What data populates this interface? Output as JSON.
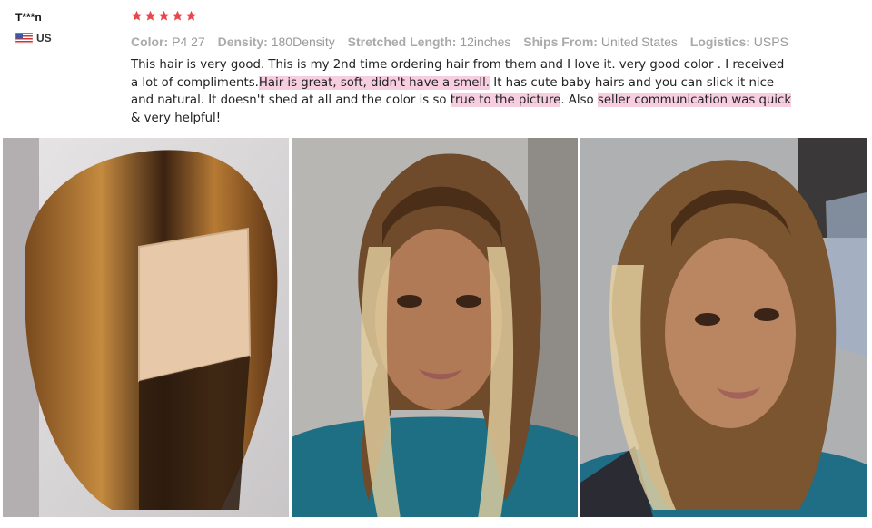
{
  "reviewer": {
    "name": "T***n",
    "country": "US",
    "flag_icon": "us-flag-icon"
  },
  "rating": {
    "stars": 5,
    "max": 5,
    "color": "#e8474d"
  },
  "attributes": [
    {
      "key": "Color:",
      "value": "P4 27"
    },
    {
      "key": "Density:",
      "value": "180Density"
    },
    {
      "key": "Stretched Length:",
      "value": "12inches"
    },
    {
      "key": "Ships From:",
      "value": "United States"
    },
    {
      "key": "Logistics:",
      "value": "USPS"
    }
  ],
  "review_text": {
    "s1": "This hair is very good. This is my 2nd time ordering hair from them and I love it. very good color . I received a lot of compliments.",
    "h1": "Hair is great, soft, didn't have a smell.",
    "s2": " It has cute baby hairs and you can slick it nice and natural. It doesn't shed at all and the color is so ",
    "h2": "true to the picture",
    "s3": ". Also ",
    "h3": "seller communication was quick",
    "s4": " & very helpful!"
  },
  "highlight_color": "#f7cde0",
  "photos": [
    {
      "name": "wig-on-mannequin-photo"
    },
    {
      "name": "customer-front-photo"
    },
    {
      "name": "customer-angled-photo"
    }
  ]
}
